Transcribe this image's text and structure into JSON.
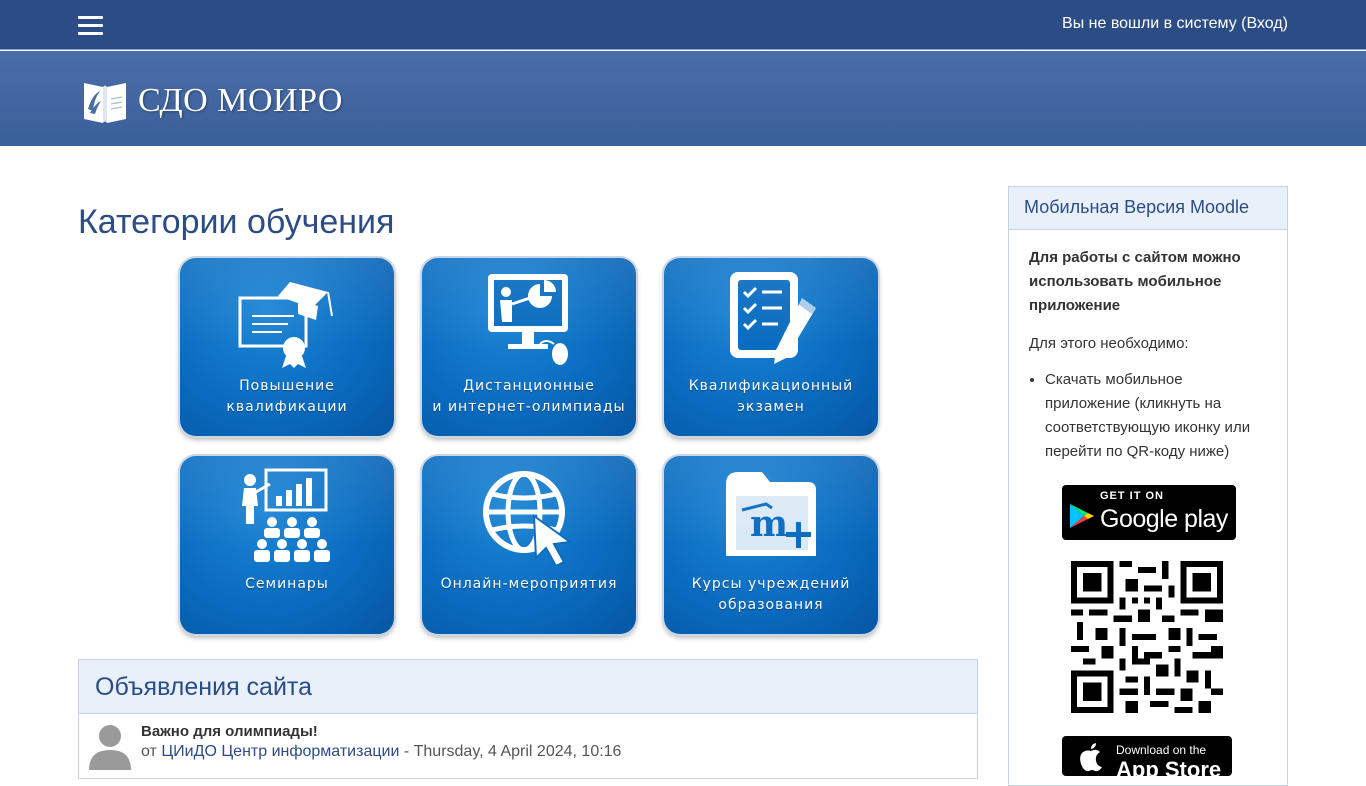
{
  "header": {
    "menu_icon": "hamburger-icon",
    "login_text": "Вы не вошли в систему (Вход)",
    "logo_text": "СДО МОИРО",
    "colors": {
      "topbar": "#2c4c85",
      "banner": "#3f65a2"
    }
  },
  "main": {
    "title": "Категории обучения",
    "tiles": [
      {
        "line1": "Повышение",
        "line2": "квалификации",
        "icon": "certificate-graduation-icon"
      },
      {
        "line1": "Дистанционные",
        "line2": "и интернет-олимпиады",
        "icon": "presentation-computer-icon"
      },
      {
        "line1": "Квалификационный",
        "line2": "экзамен",
        "icon": "checklist-pencil-icon"
      },
      {
        "line1": "Семинары",
        "line2": "",
        "icon": "seminar-audience-icon"
      },
      {
        "line1": "Онлайн-мероприятия",
        "line2": "",
        "icon": "globe-cursor-icon"
      },
      {
        "line1": "Курсы учреждений",
        "line2": "образования",
        "icon": "moodle-folder-plus-icon"
      }
    ]
  },
  "news": {
    "title": "Объявления сайта",
    "item_title": "Важно для олимпиады!",
    "by": "от",
    "author": "ЦИиДО Центр информатизации",
    "date": "- Thursday, 4 April 2024, 10:16"
  },
  "sidebar": {
    "title": "Мобильная Версия Moodle",
    "bold_text": "Для работы с сайтом можно использовать мобильное приложение",
    "need_text": "Для этого необходимо:",
    "list_item": "Скачать мобильное приложение (кликнуть на соответствующую иконку или перейти по QR-коду ниже)",
    "google_small": "GET IT ON",
    "google_big": "Google play",
    "apple_small": "Download on the",
    "apple_big": "App Store"
  }
}
